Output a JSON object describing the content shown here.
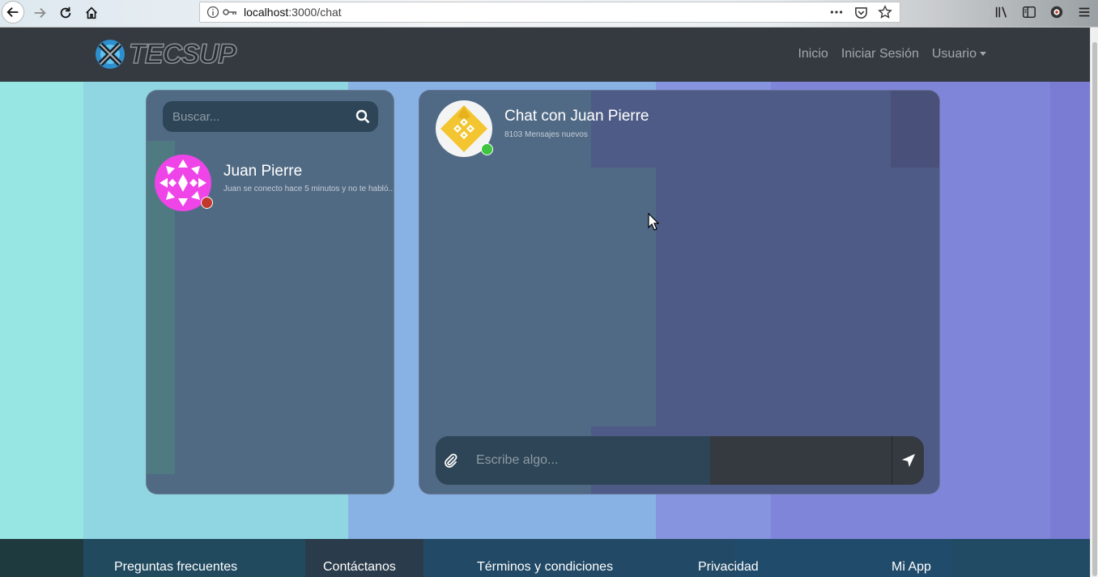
{
  "browser": {
    "url_host": "localhost",
    "url_path": ":3000/chat"
  },
  "navbar": {
    "brand": "TECSUP",
    "links": [
      "Inicio",
      "Iniciar Sesión",
      "Usuario"
    ]
  },
  "sidebar": {
    "search_placeholder": "Buscar...",
    "contacts": [
      {
        "name": "Juan Pierre",
        "last_message": "Juan se conecto hace 5 minutos y no te habló...",
        "status_color": "#c0392b",
        "avatar_color": "#ee44e8"
      }
    ]
  },
  "chat": {
    "title": "Chat con Juan Pierre",
    "subtitle": "8103 Mensajes nuevos",
    "status_color": "#3fc43f",
    "avatar_color": "#f2c531",
    "input_placeholder": "Escribe algo..."
  },
  "footer": {
    "links": [
      "Preguntas frecuentes",
      "Contáctanos",
      "Términos y condiciones",
      "Privacidad",
      "Mi App"
    ]
  },
  "colors": {
    "navbar": "#343a40",
    "panel_left": "#516a84",
    "panel_right": "#4e5b86"
  }
}
